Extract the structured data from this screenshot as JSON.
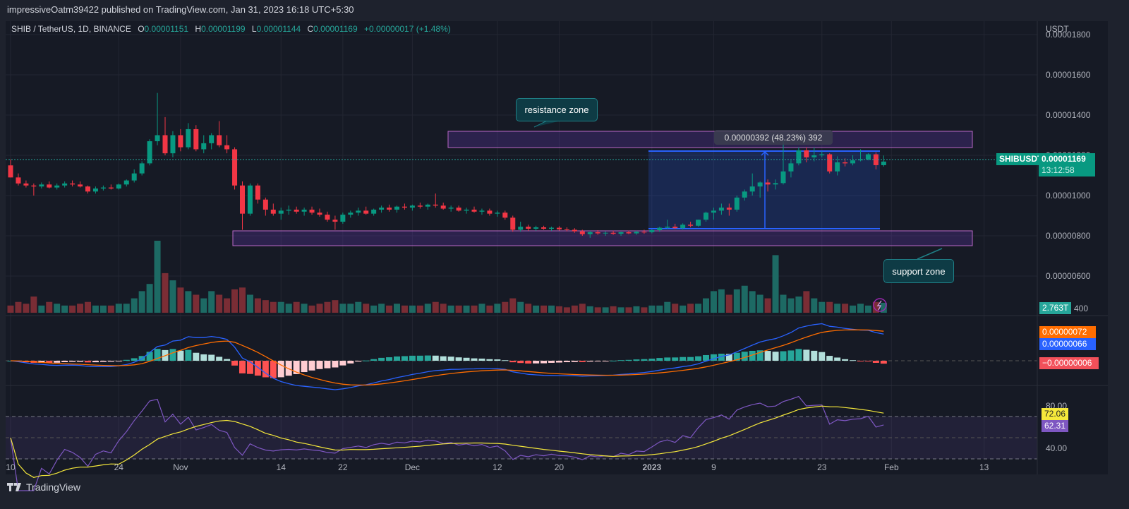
{
  "header": {
    "published": "impressiveOatm39422 published on TradingView.com, Jan 31, 2023 16:18 UTC+5:30"
  },
  "legend": {
    "symbol": "SHIB / TetherUS, 1D, BINANCE",
    "o_label": "O",
    "o": "0.00001151",
    "h_label": "H",
    "h": "0.00001199",
    "l_label": "L",
    "l": "0.00001144",
    "c_label": "C",
    "c": "0.00001169",
    "change": "+0.00000017 (+1.48%)"
  },
  "price_axis": {
    "unit": "USDT",
    "ticks": [
      {
        "label": "0.00001800",
        "value": 1800
      },
      {
        "label": "0.00001600",
        "value": 1600
      },
      {
        "label": "0.00001400",
        "value": 1400
      },
      {
        "label": "0.00001200",
        "value": 1200
      },
      {
        "label": "0.00001000",
        "value": 1000
      },
      {
        "label": "0.00000800",
        "value": 800
      },
      {
        "label": "0.00000600",
        "value": 600
      }
    ],
    "volume_tick": "400"
  },
  "tags": {
    "symbol": "SHIBUSDT",
    "last_price": "0.00001169",
    "countdown": "13:12:58",
    "volume": "2.763T",
    "macd_signal": "0.00000072",
    "macd": "0.00000066",
    "macd_hist": "−0.00000006",
    "rsi_ma": "72.06",
    "rsi": "62.31"
  },
  "rsi_axis": {
    "ticks": [
      {
        "label": "80.00",
        "value": 80
      },
      {
        "label": "40.00",
        "value": 40
      }
    ]
  },
  "drawings": {
    "resistance_label": "resistance zone",
    "support_label": "support zone",
    "measure_label": "0.00000392 (48.23%) 392"
  },
  "footer": {
    "brand": "TradingView"
  },
  "colors": {
    "up": "#089981",
    "down": "#f23645",
    "macd": "#2962ff",
    "signal": "#ff6d00",
    "rsi": "#7e57c2",
    "rsi_ma": "#f5e83b",
    "zone": "#ba68c8"
  },
  "chart_data": {
    "type": "candlestick",
    "title": "SHIB / TetherUS, 1D, BINANCE",
    "price_unit": "1e-8 USDT",
    "x_ticks": [
      {
        "label": "10",
        "day": 0
      },
      {
        "label": "24",
        "day": 14
      },
      {
        "label": "Nov",
        "day": 22
      },
      {
        "label": "14",
        "day": 35
      },
      {
        "label": "22",
        "day": 43
      },
      {
        "label": "Dec",
        "day": 52
      },
      {
        "label": "12",
        "day": 63
      },
      {
        "label": "20",
        "day": 71
      },
      {
        "label": "2023",
        "day": 83
      },
      {
        "label": "9",
        "day": 91
      },
      {
        "label": "23",
        "day": 105
      },
      {
        "label": "Feb",
        "day": 114
      },
      {
        "label": "13",
        "day": 126
      }
    ],
    "ohlc": [
      [
        1150,
        1180,
        1090,
        1090
      ],
      [
        1090,
        1110,
        1050,
        1060
      ],
      [
        1060,
        1075,
        1040,
        1050
      ],
      [
        1050,
        1060,
        1000,
        1045
      ],
      [
        1045,
        1065,
        1035,
        1055
      ],
      [
        1055,
        1070,
        1035,
        1040
      ],
      [
        1040,
        1060,
        1030,
        1050
      ],
      [
        1050,
        1070,
        1040,
        1060
      ],
      [
        1060,
        1075,
        1045,
        1055
      ],
      [
        1055,
        1070,
        1040,
        1045
      ],
      [
        1045,
        1050,
        1010,
        1020
      ],
      [
        1020,
        1045,
        1010,
        1035
      ],
      [
        1035,
        1050,
        1025,
        1040
      ],
      [
        1040,
        1055,
        1030,
        1035
      ],
      [
        1035,
        1060,
        1030,
        1055
      ],
      [
        1055,
        1080,
        1045,
        1075
      ],
      [
        1075,
        1130,
        1065,
        1110
      ],
      [
        1110,
        1170,
        1100,
        1160
      ],
      [
        1160,
        1280,
        1150,
        1270
      ],
      [
        1270,
        1510,
        1250,
        1300
      ],
      [
        1300,
        1390,
        1200,
        1210
      ],
      [
        1210,
        1320,
        1190,
        1300
      ],
      [
        1300,
        1330,
        1220,
        1240
      ],
      [
        1240,
        1360,
        1230,
        1330
      ],
      [
        1330,
        1350,
        1220,
        1230
      ],
      [
        1230,
        1300,
        1210,
        1260
      ],
      [
        1260,
        1310,
        1230,
        1300
      ],
      [
        1300,
        1370,
        1240,
        1250
      ],
      [
        1250,
        1300,
        1210,
        1230
      ],
      [
        1230,
        1240,
        1030,
        1050
      ],
      [
        1050,
        1070,
        830,
        910
      ],
      [
        910,
        1060,
        900,
        1050
      ],
      [
        1050,
        1060,
        960,
        980
      ],
      [
        980,
        990,
        900,
        930
      ],
      [
        930,
        960,
        900,
        910
      ],
      [
        910,
        940,
        880,
        925
      ],
      [
        925,
        950,
        905,
        930
      ],
      [
        930,
        945,
        910,
        920
      ],
      [
        920,
        940,
        900,
        930
      ],
      [
        930,
        945,
        905,
        915
      ],
      [
        915,
        935,
        895,
        905
      ],
      [
        905,
        920,
        870,
        880
      ],
      [
        880,
        900,
        830,
        870
      ],
      [
        870,
        915,
        860,
        905
      ],
      [
        905,
        925,
        890,
        915
      ],
      [
        915,
        940,
        900,
        925
      ],
      [
        925,
        945,
        905,
        910
      ],
      [
        910,
        935,
        900,
        930
      ],
      [
        930,
        950,
        915,
        940
      ],
      [
        940,
        955,
        920,
        930
      ],
      [
        930,
        950,
        915,
        945
      ],
      [
        945,
        960,
        930,
        940
      ],
      [
        940,
        955,
        925,
        950
      ],
      [
        950,
        965,
        935,
        945
      ],
      [
        945,
        960,
        930,
        955
      ],
      [
        955,
        1010,
        940,
        950
      ],
      [
        950,
        965,
        930,
        935
      ],
      [
        935,
        950,
        920,
        940
      ],
      [
        940,
        950,
        920,
        925
      ],
      [
        925,
        940,
        910,
        930
      ],
      [
        930,
        945,
        915,
        920
      ],
      [
        920,
        935,
        905,
        925
      ],
      [
        925,
        935,
        900,
        910
      ],
      [
        910,
        925,
        895,
        915
      ],
      [
        915,
        925,
        880,
        890
      ],
      [
        890,
        900,
        820,
        830
      ],
      [
        830,
        870,
        820,
        845
      ],
      [
        845,
        855,
        825,
        835
      ],
      [
        835,
        850,
        825,
        842
      ],
      [
        842,
        850,
        830,
        835
      ],
      [
        835,
        845,
        825,
        840
      ],
      [
        840,
        848,
        826,
        832
      ],
      [
        832,
        842,
        822,
        830
      ],
      [
        830,
        838,
        815,
        822
      ],
      [
        822,
        830,
        800,
        808
      ],
      [
        808,
        825,
        790,
        818
      ],
      [
        818,
        828,
        805,
        812
      ],
      [
        812,
        822,
        800,
        815
      ],
      [
        815,
        825,
        805,
        810
      ],
      [
        810,
        820,
        800,
        818
      ],
      [
        818,
        826,
        808,
        812
      ],
      [
        812,
        825,
        805,
        820
      ],
      [
        820,
        830,
        810,
        818
      ],
      [
        818,
        832,
        812,
        828
      ],
      [
        828,
        845,
        820,
        840
      ],
      [
        840,
        880,
        835,
        845
      ],
      [
        845,
        860,
        832,
        838
      ],
      [
        838,
        862,
        830,
        855
      ],
      [
        855,
        870,
        842,
        850
      ],
      [
        850,
        880,
        845,
        880
      ],
      [
        880,
        920,
        870,
        915
      ],
      [
        915,
        940,
        880,
        925
      ],
      [
        925,
        960,
        905,
        940
      ],
      [
        940,
        960,
        900,
        930
      ],
      [
        930,
        1000,
        920,
        990
      ],
      [
        990,
        1030,
        975,
        1020
      ],
      [
        1020,
        1110,
        1000,
        1045
      ],
      [
        1045,
        1070,
        990,
        1065
      ],
      [
        1065,
        1080,
        1020,
        1055
      ],
      [
        1055,
        1080,
        1030,
        1062
      ],
      [
        1062,
        1270,
        1055,
        1120
      ],
      [
        1120,
        1175,
        1090,
        1160
      ],
      [
        1160,
        1240,
        1150,
        1225
      ],
      [
        1225,
        1240,
        1165,
        1190
      ],
      [
        1190,
        1240,
        1170,
        1200
      ],
      [
        1200,
        1220,
        1190,
        1205
      ],
      [
        1205,
        1210,
        1110,
        1120
      ],
      [
        1120,
        1195,
        1100,
        1165
      ],
      [
        1165,
        1185,
        1145,
        1160
      ],
      [
        1160,
        1200,
        1150,
        1175
      ],
      [
        1175,
        1230,
        1170,
        1180
      ],
      [
        1180,
        1210,
        1175,
        1205
      ],
      [
        1205,
        1215,
        1130,
        1151
      ],
      [
        1151,
        1199,
        1144,
        1169
      ]
    ],
    "volume_T": [
      2,
      3,
      2.5,
      4.5,
      2,
      3,
      2.5,
      2,
      2,
      2.5,
      3,
      2,
      2,
      2,
      2.5,
      2.5,
      4,
      6,
      8,
      20,
      11,
      9,
      7,
      6,
      5,
      4,
      6,
      5,
      4,
      6.5,
      7,
      5,
      4,
      3.5,
      3,
      3,
      2.5,
      3,
      2.5,
      2,
      2.5,
      3,
      3.5,
      2.5,
      2.5,
      3,
      2.5,
      2,
      2.5,
      2,
      2.5,
      2,
      2,
      2,
      2.5,
      3,
      2.5,
      2,
      2,
      2,
      2,
      2.5,
      2,
      2.5,
      3,
      4,
      3,
      2.5,
      2,
      2,
      2,
      1.8,
      1.5,
      2,
      2.5,
      1.8,
      1.5,
      1.5,
      1.8,
      1.5,
      1.5,
      1.8,
      1.5,
      2,
      2,
      3,
      2.5,
      2,
      2.5,
      2.5,
      4,
      6,
      6.5,
      5,
      6.5,
      7.5,
      6,
      5,
      4,
      16,
      5,
      4,
      4.5,
      6,
      4,
      3,
      3,
      2.5,
      2.5,
      2,
      2.5,
      2,
      3,
      2.763
    ],
    "macd_params": [
      12,
      26,
      9
    ],
    "rsi_params": [
      14,
      14
    ],
    "rsi_levels": [
      70,
      50,
      30
    ]
  }
}
